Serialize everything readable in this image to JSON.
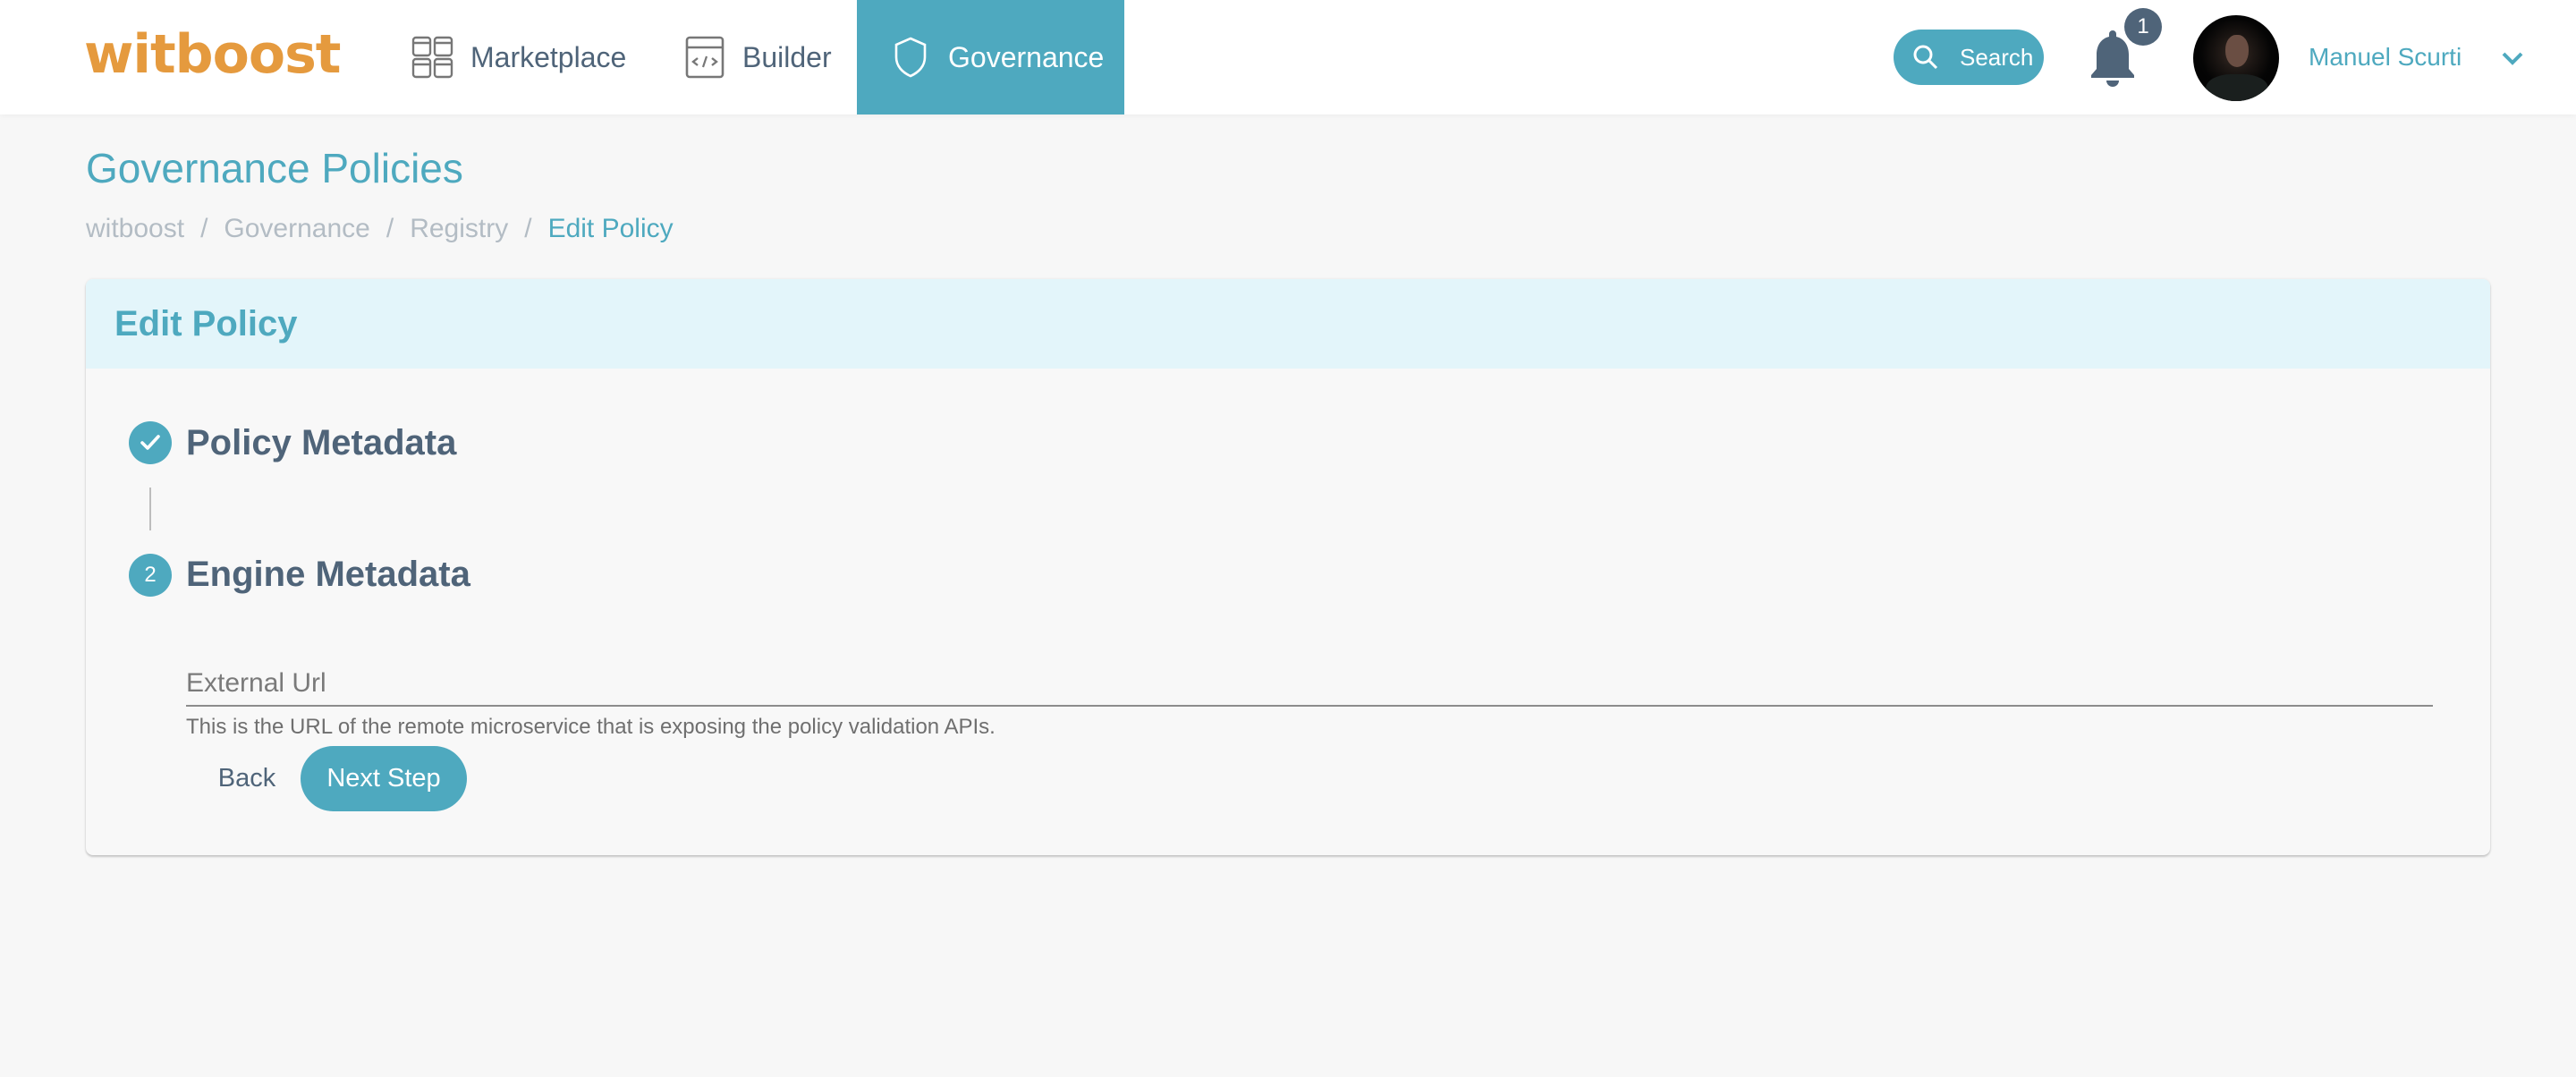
{
  "app": {
    "logo_text": "witboost",
    "brand_color": "#e59a3e",
    "accent_color": "#4ea9bf"
  },
  "nav": {
    "items": [
      {
        "label": "Marketplace",
        "icon": "marketplace-grid-icon",
        "active": false
      },
      {
        "label": "Builder",
        "icon": "builder-code-window-icon",
        "active": false
      },
      {
        "label": "Governance",
        "icon": "shield-icon",
        "active": true
      }
    ]
  },
  "toolbar": {
    "search_label": "Search",
    "notifications_count": "1",
    "user_name": "Manuel Scurti"
  },
  "page": {
    "title": "Governance Policies",
    "breadcrumb": [
      {
        "label": "witboost"
      },
      {
        "label": "Governance"
      },
      {
        "label": "Registry"
      },
      {
        "label": "Edit Policy",
        "current": true
      }
    ],
    "breadcrumb_separator": "/"
  },
  "card": {
    "title": "Edit Policy",
    "steps": [
      {
        "number": "1",
        "label": "Policy Metadata",
        "status": "completed"
      },
      {
        "number": "2",
        "label": "Engine Metadata",
        "status": "active"
      }
    ],
    "fields": {
      "external_url": {
        "label": "External Url",
        "value": "",
        "helper_text": "This is the URL of the remote microservice that is exposing the policy validation APIs."
      }
    },
    "buttons": {
      "back_label": "Back",
      "next_label": "Next Step"
    }
  }
}
